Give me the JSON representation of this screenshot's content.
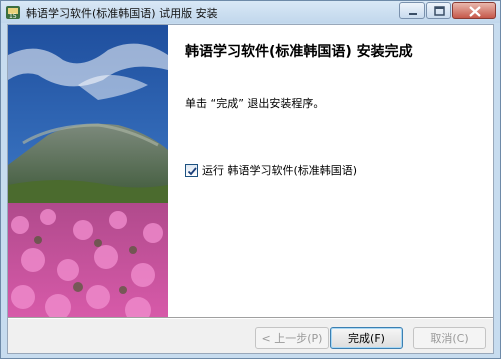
{
  "window": {
    "title": "韩语学习软件(标准韩国语) 试用版  安装",
    "app_icon": "installer-app-icon"
  },
  "caption_buttons": [
    "minimize-icon",
    "maximize-icon",
    "close-icon"
  ],
  "page": {
    "heading": "韩语学习软件(标准韩国语) 安装完成",
    "message": "单击 “完成” 退出安装程序。",
    "run_checkbox": {
      "label": "运行 韩语学习软件(标准韩国语)",
      "checked": true
    }
  },
  "buttons": {
    "back": "< 上一步(P)",
    "finish": "完成(F)",
    "cancel": "取消(C)"
  },
  "colors": {
    "title_bar": "#c7dcef",
    "close_button": "#c6584a",
    "content_bg": "#ffffff",
    "dialog_bg": "#f0f0f0"
  }
}
